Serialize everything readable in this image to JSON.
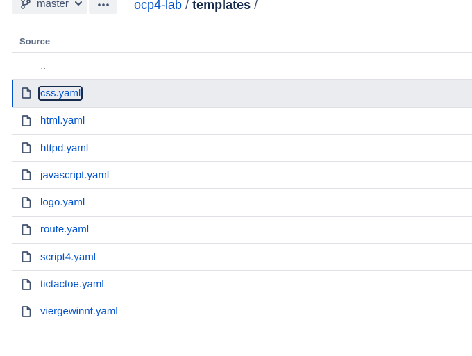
{
  "toolbar": {
    "branch_label": "master",
    "branch_icon": "branch-icon",
    "more_icon": "more-icon"
  },
  "breadcrumb": {
    "repo": "ocp4-lab",
    "separator": "/",
    "current": "templates",
    "trailing": "/"
  },
  "table": {
    "header": "Source",
    "parent_label": "..",
    "files": [
      {
        "name": "css.yaml",
        "selected": true
      },
      {
        "name": "html.yaml",
        "selected": false
      },
      {
        "name": "httpd.yaml",
        "selected": false
      },
      {
        "name": "javascript.yaml",
        "selected": false
      },
      {
        "name": "logo.yaml",
        "selected": false
      },
      {
        "name": "route.yaml",
        "selected": false
      },
      {
        "name": "script4.yaml",
        "selected": false
      },
      {
        "name": "tictactoe.yaml",
        "selected": false
      },
      {
        "name": "viergewinnt.yaml",
        "selected": false
      }
    ]
  },
  "colors": {
    "link": "#0052cc",
    "text": "#172b4d",
    "muted": "#5e6c84",
    "border": "#dfe1e6",
    "selected_bg": "#ebecf0"
  }
}
